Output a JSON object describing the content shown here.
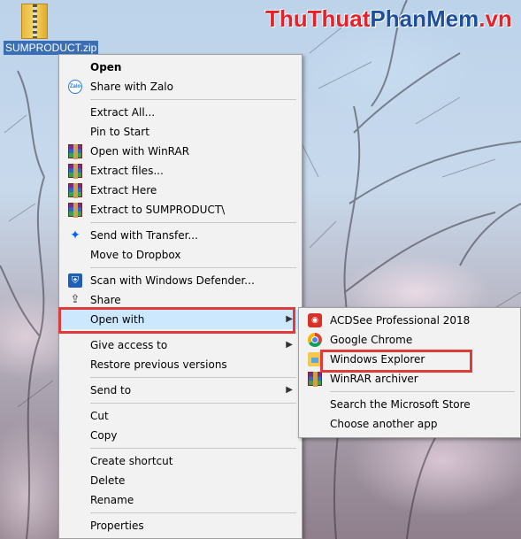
{
  "desktop": {
    "file_label": "SUMPRODUCT.zip",
    "watermark": {
      "part1": "ThuThuat",
      "part2": "PhanMem",
      "part3": ".vn"
    }
  },
  "context_menu": {
    "open": "Open",
    "share_zalo": "Share with Zalo",
    "extract_all": "Extract All...",
    "pin_start": "Pin to Start",
    "open_winrar": "Open with WinRAR",
    "extract_files": "Extract files...",
    "extract_here": "Extract Here",
    "extract_to": "Extract to SUMPRODUCT\\",
    "send_transfer": "Send with Transfer...",
    "move_dropbox": "Move to Dropbox",
    "scan_defender": "Scan with Windows Defender...",
    "share": "Share",
    "open_with": "Open with",
    "give_access": "Give access to",
    "restore_versions": "Restore previous versions",
    "send_to": "Send to",
    "cut": "Cut",
    "copy": "Copy",
    "create_shortcut": "Create shortcut",
    "delete": "Delete",
    "rename": "Rename",
    "properties": "Properties"
  },
  "open_with_submenu": {
    "acdsee": "ACDSee Professional 2018",
    "chrome": "Google Chrome",
    "explorer": "Windows Explorer",
    "winrar": "WinRAR archiver",
    "store": "Search the Microsoft Store",
    "another_app": "Choose another app"
  },
  "colors": {
    "highlight": "#e03a3a",
    "menu_bg": "#f2f2f2",
    "hover_bg": "#cce8ff"
  }
}
